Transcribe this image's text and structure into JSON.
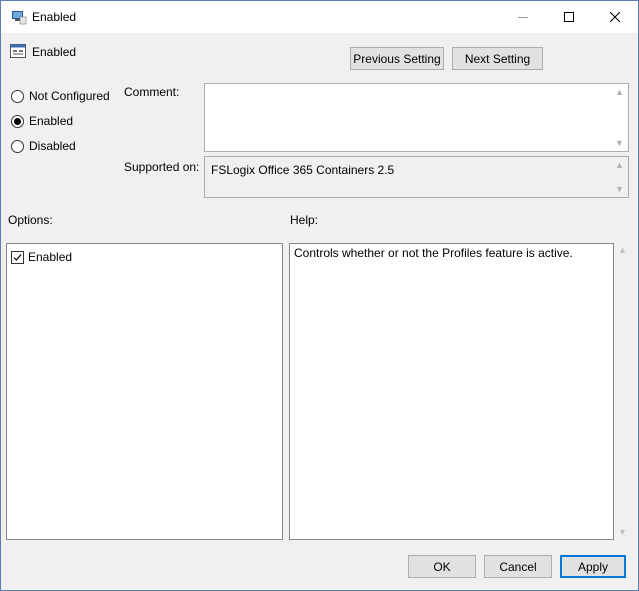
{
  "window": {
    "title": "Enabled",
    "controls": {
      "minimize": "minimize-icon",
      "maximize": "maximize-icon",
      "close": "close-icon"
    }
  },
  "setting": {
    "name": "Enabled"
  },
  "nav": {
    "previous": "Previous Setting",
    "next": "Next Setting"
  },
  "state": {
    "options": [
      {
        "label": "Not Configured",
        "selected": false
      },
      {
        "label": "Enabled",
        "selected": true
      },
      {
        "label": "Disabled",
        "selected": false
      }
    ]
  },
  "comment": {
    "label": "Comment:",
    "value": ""
  },
  "supported": {
    "label": "Supported on:",
    "value": "FSLogix Office 365 Containers 2.5"
  },
  "options_panel": {
    "label": "Options:",
    "checkbox_label": "Enabled",
    "checked": true
  },
  "help_panel": {
    "label": "Help:",
    "text": "Controls whether or not the Profiles feature is active."
  },
  "footer": {
    "ok": "OK",
    "cancel": "Cancel",
    "apply": "Apply"
  },
  "colors": {
    "accent": "#0078d7",
    "dialog_bg": "#f0f0f0"
  }
}
